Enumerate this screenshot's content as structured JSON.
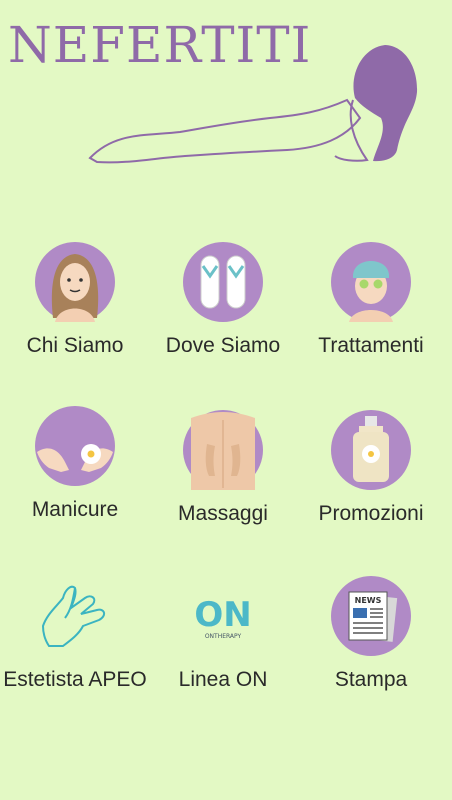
{
  "app": {
    "title": "NEFERTITI"
  },
  "colors": {
    "background": "#e3f9c4",
    "accent": "#8f6aa8",
    "circle": "#b08ac6"
  },
  "menu": [
    {
      "label": "Chi Siamo",
      "icon": "woman-face-icon"
    },
    {
      "label": "Dove Siamo",
      "icon": "flip-flops-icon"
    },
    {
      "label": "Trattamenti",
      "icon": "face-mask-icon"
    },
    {
      "label": "Manicure",
      "icon": "manicure-hands-icon"
    },
    {
      "label": "Massaggi",
      "icon": "massage-back-icon"
    },
    {
      "label": "Promozioni",
      "icon": "lotion-bottle-icon"
    },
    {
      "label": "Estetista APEO",
      "icon": "apeo-hands-icon"
    },
    {
      "label": "Linea ON",
      "icon": "ontherapy-logo-icon",
      "logo_text": "ON",
      "logo_subtext": "ONTHERAPY"
    },
    {
      "label": "Stampa",
      "icon": "newspaper-icon",
      "badge_text": "NEWS"
    }
  ]
}
